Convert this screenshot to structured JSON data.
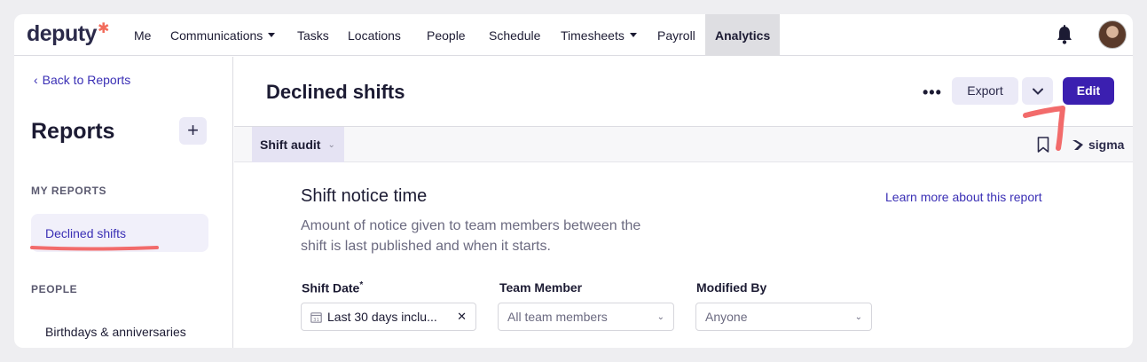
{
  "app": {
    "logo_text": "deputy",
    "logo_mark": "✱"
  },
  "nav": {
    "items": [
      {
        "label": "Me"
      },
      {
        "label": "Communications",
        "has_caret": true
      },
      {
        "label": "Tasks"
      },
      {
        "label": "Locations"
      },
      {
        "label": "People"
      },
      {
        "label": "Schedule"
      },
      {
        "label": "Timesheets",
        "has_caret": true
      },
      {
        "label": "Payroll"
      },
      {
        "label": "Analytics",
        "active": true
      }
    ]
  },
  "sidebar": {
    "back_link": "Back to Reports",
    "title": "Reports",
    "add_label": "+",
    "my_reports_label": "MY REPORTS",
    "active_item": "Declined shifts",
    "people_label": "PEOPLE",
    "people_items": [
      "Birthdays & anniversaries"
    ]
  },
  "main": {
    "title": "Declined shifts",
    "more_label": "•••",
    "export_label": "Export",
    "edit_label": "Edit",
    "tab_label": "Shift audit",
    "sigma_label": "sigma",
    "report_heading": "Shift notice time",
    "report_desc": "Amount of notice given to team members between the shift is last published and when it starts.",
    "learn_more": "Learn more about this report"
  },
  "filters": {
    "shift_date": {
      "label": "Shift Date",
      "required_mark": "*",
      "value": "Last 30 days inclu..."
    },
    "team_member": {
      "label": "Team Member",
      "placeholder": "All team members"
    },
    "modified_by": {
      "label": "Modified By",
      "placeholder": "Anyone"
    }
  },
  "colors": {
    "accent": "#3b1fb0",
    "link": "#3a2fb5",
    "annotation": "#f26b6b"
  }
}
